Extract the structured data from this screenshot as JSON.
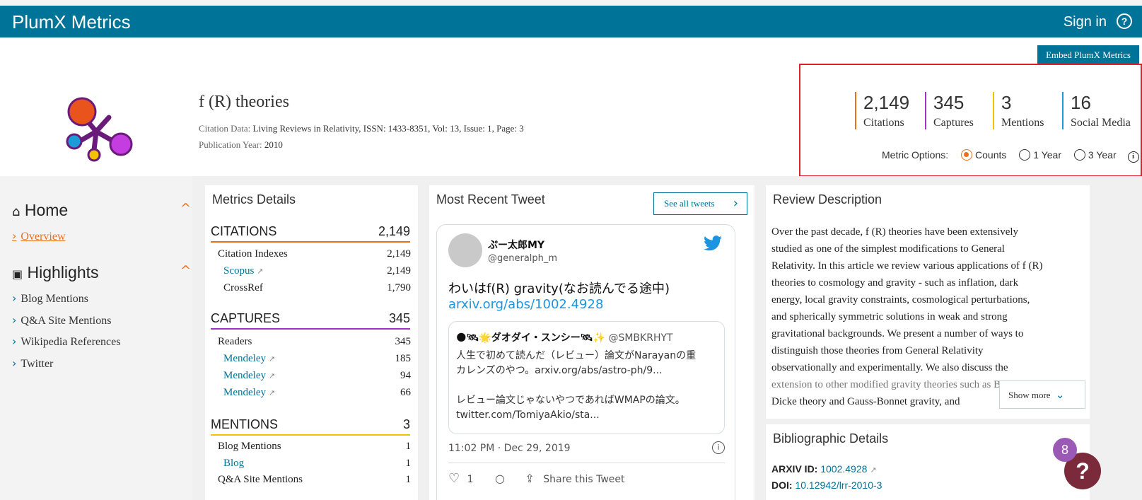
{
  "header": {
    "brand": "PlumX Metrics",
    "sign_in": "Sign in",
    "help_icon": "?"
  },
  "embed_button": "Embed PlumX Metrics",
  "article": {
    "title": "f (R) theories",
    "citation_label": "Citation Data:",
    "citation_value": "Living Reviews in Relativity, ISSN: 1433-8351, Vol: 13, Issue: 1, Page: 3",
    "pubyear_label": "Publication Year:",
    "pubyear_value": "2010"
  },
  "summary_metrics": [
    {
      "value": "2,149",
      "label": "Citations",
      "color": "#e9711c"
    },
    {
      "value": "345",
      "label": "Captures",
      "color": "#a230c9"
    },
    {
      "value": "3",
      "label": "Mentions",
      "color": "#f2c200"
    },
    {
      "value": "16",
      "label": "Social Media",
      "color": "#1b9bd7"
    }
  ],
  "metric_options": {
    "label": "Metric Options:",
    "options": [
      "Counts",
      "1 Year",
      "3 Year"
    ],
    "selected": "Counts"
  },
  "sidebar": {
    "home": "Home",
    "overview": "Overview",
    "highlights": "Highlights",
    "items": [
      "Blog Mentions",
      "Q&A Site Mentions",
      "Wikipedia References",
      "Twitter"
    ]
  },
  "metrics_details": {
    "title": "Metrics Details",
    "citations": {
      "label": "CITATIONS",
      "value": "2,149",
      "rows": [
        {
          "label": "Citation Indexes",
          "value": "2,149"
        },
        {
          "label": "Scopus",
          "value": "2,149"
        },
        {
          "label": "CrossRef",
          "value": "1,790"
        }
      ]
    },
    "captures": {
      "label": "CAPTURES",
      "value": "345",
      "rows": [
        {
          "label": "Readers",
          "value": "345"
        },
        {
          "label": "Mendeley",
          "value": "185"
        },
        {
          "label": "Mendeley",
          "value": "94"
        },
        {
          "label": "Mendeley",
          "value": "66"
        }
      ]
    },
    "mentions": {
      "label": "MENTIONS",
      "value": "3",
      "rows": [
        {
          "label": "Blog Mentions",
          "value": "1"
        },
        {
          "label": "Blog",
          "value": "1"
        },
        {
          "label": "Q&A Site Mentions",
          "value": "1"
        }
      ]
    }
  },
  "tweet": {
    "panel_title": "Most Recent Tweet",
    "see_all": "See all tweets",
    "username": "ぷー太郎MY",
    "handle": "@generalph_m",
    "text": "わいはf(R) gravity(なお読んでる途中)",
    "link": "arxiv.org/abs/1002.4928",
    "quoted_name": "🌑🛰🌟ダオダイ・スンシー🛰✨",
    "quoted_handle": "@SMBKRHYT",
    "quoted_line1": "人生で初めて読んだ（レビュー）論文がNarayanの重",
    "quoted_line2": "カレンズのやつ。arxiv.org/abs/astro-ph/9...",
    "quoted_line3": "レビュー論文じゃないやつであればWMAPの論文。",
    "quoted_line4": "twitter.com/TomiyaAkio/sta...",
    "time": "11:02 PM · Dec 29, 2019",
    "likes": "1",
    "share": "Share this Tweet"
  },
  "review": {
    "title": "Review Description",
    "lines": [
      "Over the past decade, f (R) theories have been extensively",
      "studied as one of the simplest modifications to General",
      "Relativity. In this article we review various applications of f (R)",
      "theories to cosmology and gravity - such as inflation, dark",
      "energy, local gravity constraints, cosmological perturbations,",
      "and spherically symmetric solutions in weak and strong",
      "gravitational backgrounds. We present a number of ways to",
      "distinguish those theories from General Relativity",
      "observationally and experimentally. We also discuss the",
      "extension to other modified gravity theories such as Brans-",
      "Dicke theory and Gauss-Bonnet gravity, and"
    ],
    "show_more": "Show more"
  },
  "bibliographic": {
    "title": "Bibliographic Details",
    "arxiv_label": "ARXIV ID:",
    "arxiv_value": "1002.4928",
    "doi_label": "DOI:",
    "doi_value": "10.12942/lrr-2010-3"
  },
  "help_widget": {
    "badge": "8",
    "icon": "?"
  }
}
